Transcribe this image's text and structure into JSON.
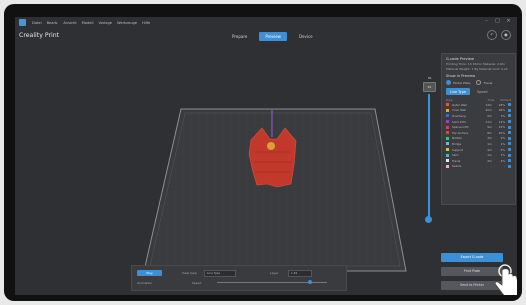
{
  "app": {
    "title": "Creality Print",
    "menu": [
      "Datei",
      "Bearb.",
      "Ansicht",
      "Modell",
      "Vorlage",
      "Werkzeuge",
      "Hilfe"
    ],
    "tabs": [
      {
        "label": "Prepare",
        "active": false
      },
      {
        "label": "Preview",
        "active": true
      },
      {
        "label": "Device",
        "active": false
      }
    ],
    "window_controls": [
      "–",
      "□",
      "×"
    ],
    "accent": "#3d8fd6"
  },
  "viewport": {
    "layer_top": "81",
    "layer_box": "81"
  },
  "panel": {
    "heading": "G-code Preview",
    "line1": "Printing Time: 1h 15min  Material: 2.6m",
    "line2": "Material Weight: 7.8g  Material Cost: 0.22",
    "show_heading": "Show in Preview",
    "radio": [
      {
        "label": "Model Plate",
        "on": true
      },
      {
        "label": "Travel",
        "on": false
      }
    ],
    "modes": [
      {
        "label": "Line Type",
        "on": true
      },
      {
        "label": "Speed",
        "on": false
      }
    ],
    "color_header": [
      "Type",
      "Time",
      "Percent"
    ],
    "colors": [
      {
        "name": "Outer Wall",
        "time": "14m",
        "pct": "18%",
        "color": "#e05a3a"
      },
      {
        "name": "Inner Wall",
        "time": "20m",
        "pct": "26%",
        "color": "#e6a23a"
      },
      {
        "name": "Overhang",
        "time": "2m",
        "pct": "3%",
        "color": "#2f6fd4"
      },
      {
        "name": "Solid Infill",
        "time": "11m",
        "pct": "14%",
        "color": "#9b3bd1"
      },
      {
        "name": "Sparse Infill",
        "time": "9m",
        "pct": "12%",
        "color": "#d83b6a"
      },
      {
        "name": "Top Surface",
        "time": "8m",
        "pct": "10%",
        "color": "#d24a3a"
      },
      {
        "name": "Bottom",
        "time": "3m",
        "pct": "4%",
        "color": "#3ac16b"
      },
      {
        "name": "Bridge",
        "time": "1m",
        "pct": "1%",
        "color": "#6fb5e0"
      },
      {
        "name": "Support",
        "time": "4m",
        "pct": "5%",
        "color": "#c9c15a"
      },
      {
        "name": "Skirt",
        "time": "1m",
        "pct": "1%",
        "color": "#3fbfb0"
      },
      {
        "name": "Travel",
        "time": "3m",
        "pct": "4%",
        "color": "#e8e8e8"
      },
      {
        "name": "Seams",
        "time": "-",
        "pct": "-",
        "color": "#f0b4c8"
      }
    ]
  },
  "bottom_bar": {
    "play_label": "Play",
    "view_label": "View type",
    "view_value": "Line Type",
    "layer_label": "Layer",
    "layer_value": "1-81",
    "legend_label": "Animation",
    "speed_label": "Speed"
  },
  "actions": {
    "primary": "Export G-code",
    "secondary": "Print Plate",
    "tertiary": "Send to Printer"
  }
}
